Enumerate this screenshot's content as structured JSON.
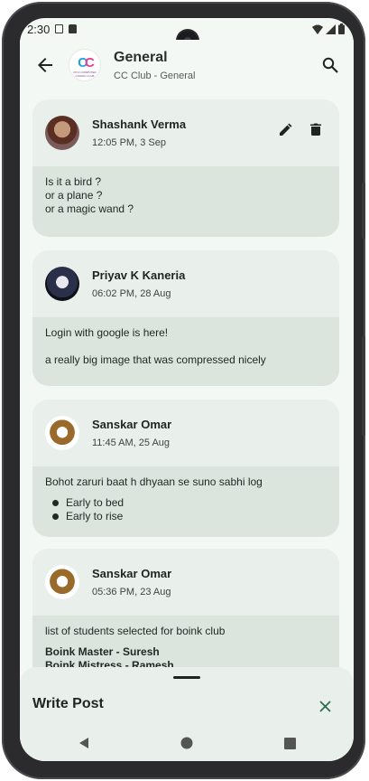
{
  "status_bar": {
    "time": "2:30"
  },
  "app_bar": {
    "title": "General",
    "subtitle": "CC Club - General",
    "logo_text": "CC",
    "logo_subtext": "IIIT-D COMPUTER CODING CLUB"
  },
  "posts": [
    {
      "author": "Shashank Verma",
      "timestamp": "12:05 PM, 3 Sep",
      "lines": [
        "Is it a bird ?",
        "or a plane ?",
        "or a magic wand ?"
      ],
      "editable": true
    },
    {
      "author": "Priyav K Kaneria",
      "timestamp": "06:02 PM, 28 Aug",
      "lines": [
        "Login with google is here!",
        "",
        "a really big image that was compressed nicely"
      ]
    },
    {
      "author": "Sanskar Omar",
      "timestamp": "11:45 AM, 25 Aug",
      "lines": [
        "Bohot zaruri baat h dhyaan se suno sabhi log"
      ],
      "bullets": [
        "Early to bed",
        "Early to rise"
      ]
    },
    {
      "author": "Sanskar Omar",
      "timestamp": "05:36 PM, 23 Aug",
      "lines": [
        "list of students selected for boink club"
      ],
      "bold_lines": [
        "Boink Master - Suresh",
        "Boink Mistress - Ramesh"
      ]
    }
  ],
  "bottom_sheet": {
    "title": "Write Post"
  },
  "colors": {
    "background": "#f3f8f4",
    "card_header": "#e9f0eb",
    "card_body": "#dbe5de",
    "accent": "#2f6b4f"
  },
  "icons": [
    "back-arrow-icon",
    "search-icon",
    "edit-icon",
    "delete-icon",
    "close-icon",
    "nav-back-icon",
    "nav-home-icon",
    "nav-recents-icon"
  ]
}
